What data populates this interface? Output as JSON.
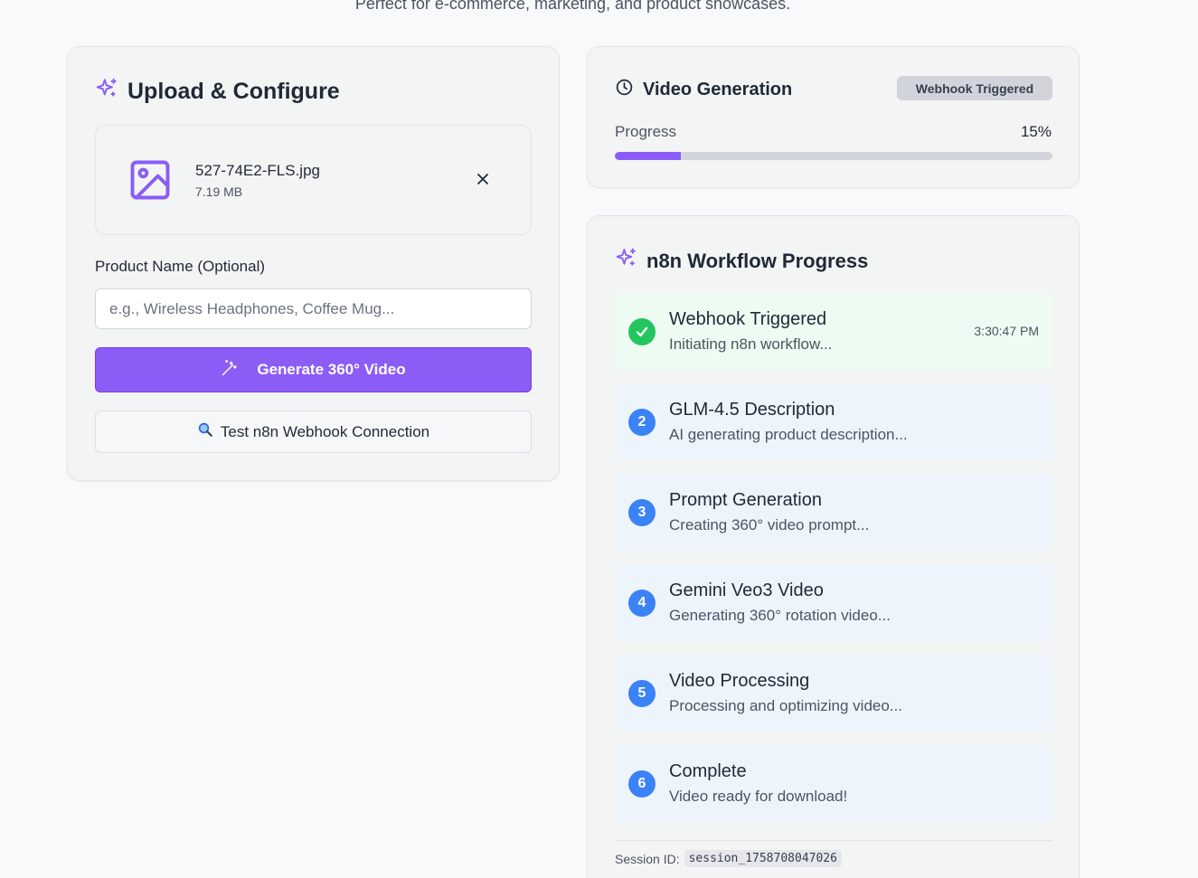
{
  "page": {
    "subtitle": "Perfect for e-commerce, marketing, and product showcases."
  },
  "upload": {
    "title": "Upload & Configure",
    "file": {
      "name": "527-74E2-FLS.jpg",
      "size": "7.19 MB"
    },
    "product_name_label": "Product Name (Optional)",
    "product_name_placeholder": "e.g., Wireless Headphones, Coffee Mug...",
    "generate_button": "Generate 360° Video",
    "test_button": "Test n8n Webhook Connection"
  },
  "video_generation": {
    "title": "Video Generation",
    "badge": "Webhook Triggered",
    "progress_label": "Progress",
    "progress_text": "15%",
    "progress": 0.15
  },
  "workflow": {
    "title": "n8n Workflow Progress",
    "steps": [
      {
        "number": "1",
        "title": "Webhook Triggered",
        "description": "Initiating n8n workflow...",
        "time": "3:30:47 PM",
        "status": "complete"
      },
      {
        "number": "2",
        "title": "GLM-4.5 Description",
        "description": "AI generating product description...",
        "status": "pending"
      },
      {
        "number": "3",
        "title": "Prompt Generation",
        "description": "Creating 360° video prompt...",
        "status": "pending"
      },
      {
        "number": "4",
        "title": "Gemini Veo3 Video",
        "description": "Generating 360° rotation video...",
        "status": "pending"
      },
      {
        "number": "5",
        "title": "Video Processing",
        "description": "Processing and optimizing video...",
        "status": "pending"
      },
      {
        "number": "6",
        "title": "Complete",
        "description": "Video ready for download!",
        "status": "pending"
      }
    ],
    "session_label": "Session ID:",
    "session_id": "session_1758708047026"
  },
  "colors": {
    "accent": "#8b5cf6",
    "step_number": "#3b82f6",
    "step_done": "#22c55e"
  },
  "icons": {
    "upload_title": "sparkles-icon",
    "file": "image-icon",
    "remove": "close-icon",
    "generate": "magic-wand-icon",
    "test": "magnifier-icon",
    "video_title": "clock-icon",
    "workflow_title": "sparkles-icon",
    "step_complete": "check-icon"
  }
}
